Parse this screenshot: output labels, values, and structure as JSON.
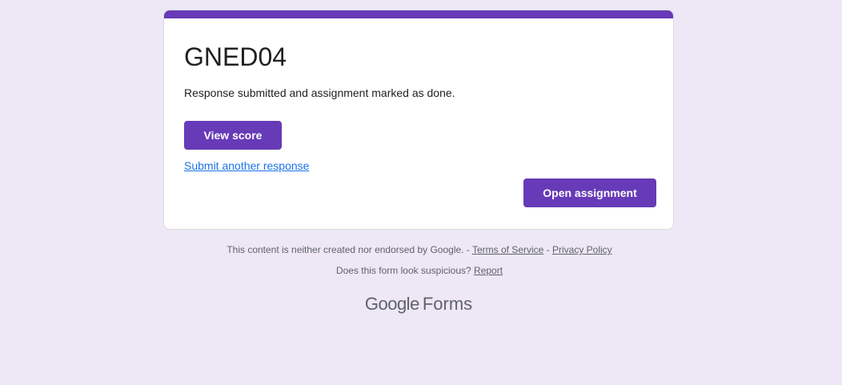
{
  "form": {
    "title": "GNED04",
    "confirmation_message": "Response submitted and assignment marked as done.",
    "view_score_label": "View score",
    "submit_another_label": "Submit another response",
    "open_assignment_label": "Open assignment"
  },
  "footer": {
    "disclaimer": "This content is neither created nor endorsed by Google.",
    "separator_1": " - ",
    "terms_label": "Terms of Service",
    "separator_2": " - ",
    "privacy_label": "Privacy Policy",
    "suspicious_text": "Does this form look suspicious?",
    "report_label": "Report"
  },
  "brand": {
    "google": "Google",
    "product": "Forms"
  },
  "colors": {
    "accent": "#673ab7",
    "background": "#ede7f6",
    "link": "#1a73e8"
  }
}
